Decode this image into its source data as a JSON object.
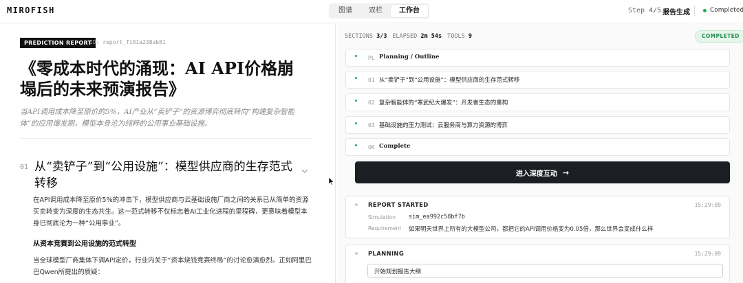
{
  "app": {
    "logo": "MIROFISH"
  },
  "header": {
    "tabs": [
      {
        "label": "图谱",
        "active": false
      },
      {
        "label": "双栏",
        "active": false
      },
      {
        "label": "工作台",
        "active": true
      }
    ],
    "step": "Step 4/5",
    "step_name": "报告生成",
    "status": "Completed",
    "status_color": "#22a85a"
  },
  "report": {
    "badge": "PREDICTION REPORT",
    "id": "ID: report_f101a238ab81",
    "title": "《零成本时代的涌现：AI API价格崩塌后的未来预演报告》",
    "subtitle": "当API调用成本降至原价的5%，AI产业从“卖铲子”的资源博弈彻底转向“构建复杂智能体”的应用爆发期，模型本身沦为纯粹的公用事业基础设施。",
    "section": {
      "number": "01",
      "title": "从“卖铲子”到“公用设施”：模型供应商的生存范式转移",
      "paragraph": "在API调用成本降至原价5%的冲击下，模型供应商与云基础设施厂商之间的关系已从简单的资源买卖转变为深度的生态共生。这一范式转移不仅标志着AI工业化进程的里程碑，更意味着模型本身已彻底沦为一种“公用事业”。",
      "subheading": "从资本竞赛到公用设施的范式转型",
      "paragraph2": "当全球模型厂商集体下调API定价，行业内关于“资本烧钱竞赛终局”的讨论愈演愈烈。正如阿里巴巴Qwen所提出的质疑："
    }
  },
  "workbench": {
    "stats": {
      "sections_label": "SECTIONS",
      "sections_value": "3/3",
      "elapsed_label": "ELAPSED",
      "elapsed_value": "2m 54s",
      "tools_label": "TOOLS",
      "tools_value": "9"
    },
    "status_pill": "COMPLETED",
    "outline": [
      {
        "num": "PL",
        "text": "Planning / Outline",
        "bold": true
      },
      {
        "num": "01",
        "text": "从“卖铲子”到“公用设施”：模型供应商的生存范式转移",
        "bold": false
      },
      {
        "num": "02",
        "text": "复杂智能体的“寒武纪大爆发”：开发者生态的重构",
        "bold": false
      },
      {
        "num": "03",
        "text": "基础设施的压力测试：云服务商与算力资源的博弈",
        "bold": false
      },
      {
        "num": "OK",
        "text": "Complete",
        "bold": true
      }
    ],
    "cta_label": "进入深度互动",
    "cta_arrow": "→",
    "log": {
      "report_started": {
        "title": "REPORT STARTED",
        "time": "15:29:09",
        "simulation_label": "Simulation",
        "simulation_value": "sim_ea992c58bf7b",
        "requirement_label": "Requirement",
        "requirement_value": "如果明天世界上所有的大模型公司，都把它的API调用价格变为0.05倍，那么世界会变成什么样"
      },
      "planning": {
        "title": "PLANNING",
        "time": "15:29:09",
        "message": "开始规划报告大纲"
      }
    }
  }
}
